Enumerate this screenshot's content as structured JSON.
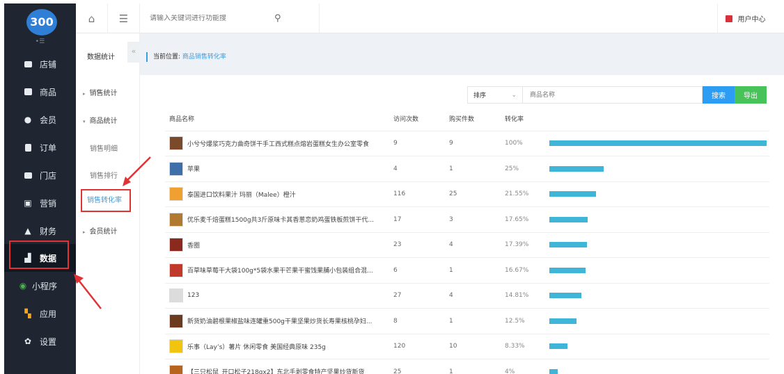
{
  "sidebar": {
    "logo": "300",
    "mini_toggle": "•☰",
    "items": [
      {
        "label": "店铺",
        "icon": "store-icon"
      },
      {
        "label": "商品",
        "icon": "goods-icon"
      },
      {
        "label": "会员",
        "icon": "member-icon"
      },
      {
        "label": "订单",
        "icon": "order-icon"
      },
      {
        "label": "门店",
        "icon": "shop-icon"
      },
      {
        "label": "营销",
        "icon": "marketing-icon"
      },
      {
        "label": "财务",
        "icon": "finance-icon"
      },
      {
        "label": "数据",
        "icon": "data-icon"
      },
      {
        "label": "小程序",
        "icon": "miniprogram-icon"
      },
      {
        "label": "应用",
        "icon": "apps-icon"
      },
      {
        "label": "设置",
        "icon": "settings-icon"
      }
    ]
  },
  "header": {
    "search_placeholder": "请输入关键词进行功能搜",
    "user_center": "用户中心"
  },
  "subnav": {
    "title": "数据统计",
    "toggle": "«",
    "groups": [
      "销售统计",
      "商品统计",
      "会员统计"
    ],
    "items": [
      "销售明细",
      "销售排行",
      "销售转化率"
    ]
  },
  "breadcrumb": {
    "label": "当前位置:",
    "current": "商品销售转化率"
  },
  "filter": {
    "sort_label": "排序",
    "product_placeholder": "商品名称",
    "search_btn": "搜索",
    "export_btn": "导出"
  },
  "table": {
    "headers": [
      "商品名称",
      "访问次数",
      "购买件数",
      "转化率"
    ],
    "rows": [
      {
        "name": "小兮兮爆浆巧克力曲奇饼干手工西式糕点熔岩蛋糕女生办公室零食",
        "visits": "9",
        "purchases": "9",
        "rate": "100%",
        "rate_value": 100
      },
      {
        "name": "苹果",
        "visits": "4",
        "purchases": "1",
        "rate": "25%",
        "rate_value": 25
      },
      {
        "name": "泰国进口饮料果汁 玛丽（Malee）橙汁",
        "visits": "116",
        "purchases": "25",
        "rate": "21.55%",
        "rate_value": 21.55
      },
      {
        "name": "优乐麦千焙蛋糕1500g共3斤原味卡其香葱恋奶鸡蛋铁板煎饼干代...",
        "visits": "17",
        "purchases": "3",
        "rate": "17.65%",
        "rate_value": 17.65
      },
      {
        "name": "香圈",
        "visits": "23",
        "purchases": "4",
        "rate": "17.39%",
        "rate_value": 17.39
      },
      {
        "name": "百草味草莓干大袋100g*5袋水果干芒果干蜜饯果脯小包装组合混...",
        "visits": "6",
        "purchases": "1",
        "rate": "16.67%",
        "rate_value": 16.67
      },
      {
        "name": "123",
        "visits": "27",
        "purchases": "4",
        "rate": "14.81%",
        "rate_value": 14.81
      },
      {
        "name": "新货奶油碧根果椒盐味连罐重500g干果坚果炒货长寿果核桃孕妇...",
        "visits": "8",
        "purchases": "1",
        "rate": "12.5%",
        "rate_value": 12.5
      },
      {
        "name": "乐事（Lay’s）薯片 休闲零食 美国经典原味 235g",
        "visits": "120",
        "purchases": "10",
        "rate": "8.33%",
        "rate_value": 8.33
      },
      {
        "name": "【三只松鼠_开口松子218gx2】东北手剥零食特产坚果炒货新货",
        "visits": "25",
        "purchases": "1",
        "rate": "4%",
        "rate_value": 4
      }
    ]
  },
  "colors": {
    "sidebar_bg": "#1f2631",
    "accent_blue": "#3a9ee4",
    "bar": "#3fb5d8",
    "search_btn": "#2d9cf3",
    "export_btn": "#48c35a",
    "annotation": "#e03333"
  }
}
